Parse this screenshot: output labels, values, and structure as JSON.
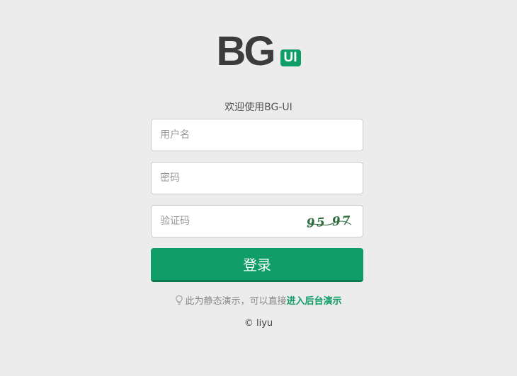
{
  "logo": {
    "main_text": "BG",
    "badge_text": "UI"
  },
  "welcome_text": "欢迎使用BG-UI",
  "form": {
    "username_placeholder": "用户名",
    "password_placeholder": "密码",
    "captcha_placeholder": "验证码",
    "captcha_text": "95 97",
    "submit_label": "登录"
  },
  "tip": {
    "icon": "lightbulb-icon",
    "text": "此为静态演示，可以直接",
    "link_text": "进入后台演示"
  },
  "copyright": {
    "symbol": "©",
    "author": "liyu"
  },
  "colors": {
    "accent": "#0f9d68",
    "background": "#ececec",
    "logo_dark": "#3c3c3c"
  }
}
